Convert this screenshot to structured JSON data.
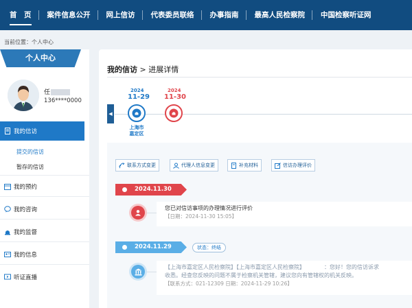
{
  "nav": {
    "items": [
      "首　页",
      "案件信息公开",
      "网上信访",
      "代表委员联络",
      "办事指南",
      "最高人民检察院",
      "中国检察听证网"
    ]
  },
  "breadcrumb": "当前位置：个人中心",
  "sidebar": {
    "title": "个人中心",
    "user_name": "任",
    "user_phone": "136****0000",
    "menu": {
      "petition": "我的信访",
      "submitted": "提交的信访",
      "draft": "暂存的信访",
      "booking": "我的预约",
      "consult": "我的咨询",
      "supervise": "我的监督",
      "info": "我的信息",
      "hearing": "听证直播"
    }
  },
  "main": {
    "title": "我的信访",
    "title_suffix": " > 进展详情",
    "timeline": [
      {
        "year": "2024",
        "date": "11-29",
        "label": "上海市\n嘉定区",
        "color": "#1f79c7"
      },
      {
        "year": "2024",
        "date": "11-30",
        "label": "",
        "color": "#e0454b"
      }
    ],
    "actions": [
      "联系方式变更",
      "代理人信息变更",
      "补充材料",
      "信访办理评价"
    ],
    "events": [
      {
        "date": "2024.11.30",
        "text": "您已对信访事项的办理情况进行评价",
        "time": "【日期：2024-11-30 15:05】"
      },
      {
        "date": "2024.11.29",
        "status": "状态：终结",
        "line1": "【上海市嘉定区人民检察院】【上海市嘉定区人民检察院】　　　　：您好！您的信访诉求",
        "line2": "收悉。经查您反映的问题不属于检察机关管辖，建议您向有管辖权的机关反映。",
        "line3": "【联系方式：021-12309 日期：2024-11-29 10:26】"
      }
    ]
  },
  "colors": {
    "nav": "#114c80",
    "accent": "#1f79c7",
    "red": "#e0454b"
  }
}
